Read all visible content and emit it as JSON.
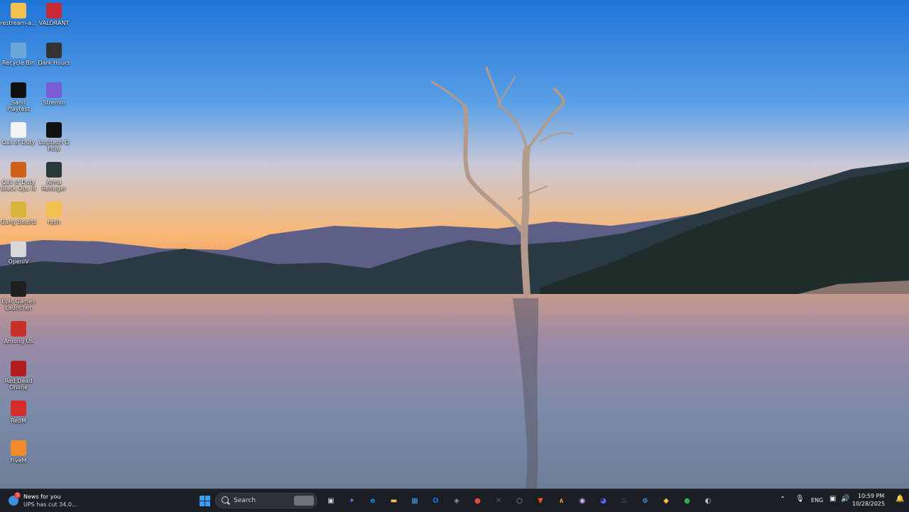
{
  "desktop": {
    "icons": [
      {
        "label": "restream-a...",
        "icon": "folder-icon",
        "color": "#f2c14e"
      },
      {
        "label": "VALORANT",
        "icon": "valorant-icon",
        "color": "#c62b33"
      },
      {
        "label": "Recycle Bin",
        "icon": "recycle-bin-icon",
        "color": "#6aa6d8"
      },
      {
        "label": "Dark Hours",
        "icon": "dark-hours-icon",
        "color": "#333333"
      },
      {
        "label": "Sand Playtest",
        "icon": "sand-icon",
        "color": "#111111"
      },
      {
        "label": "Stremio",
        "icon": "stremio-icon",
        "color": "#7b5bd6"
      },
      {
        "label": "Call of Duty",
        "icon": "file-icon",
        "color": "#f4f4f4"
      },
      {
        "label": "Logitech G HUB",
        "icon": "logitech-icon",
        "color": "#111111"
      },
      {
        "label": "Call of Duty Black Ops III",
        "icon": "black-ops-icon",
        "color": "#d0601a"
      },
      {
        "label": "Arma Reforger",
        "icon": "arma-icon",
        "color": "#2a3a3a"
      },
      {
        "label": "Gang Beasts",
        "icon": "gang-beasts-icon",
        "color": "#d9b43a"
      },
      {
        "label": "resh",
        "icon": "folder-icon",
        "color": "#f2c14e"
      },
      {
        "label": "OpenIV",
        "icon": "openiv-icon",
        "color": "#d8d8d8"
      },
      {
        "label": "Epic Games Launcher",
        "icon": "epic-games-icon",
        "color": "#202020"
      },
      {
        "label": "Among Us",
        "icon": "among-us-icon",
        "color": "#c8302a"
      },
      {
        "label": "Red Dead Online",
        "icon": "red-dead-icon",
        "color": "#b31c1c"
      },
      {
        "label": "RedM",
        "icon": "redm-icon",
        "color": "#d42b2b"
      },
      {
        "label": "FiveM",
        "icon": "fivem-icon",
        "color": "#f08a2a"
      }
    ]
  },
  "taskbar": {
    "news": {
      "title": "News for you",
      "subtitle": "UPS has cut 34,0...",
      "badge": "3"
    },
    "search": {
      "label": "Search"
    },
    "apps": [
      {
        "name": "start-button",
        "glyph": "⊞",
        "color": "#3aa0ff"
      },
      {
        "name": "task-view-button",
        "glyph": "▣",
        "color": "#cfd3dc"
      },
      {
        "name": "copilot-icon",
        "glyph": "✦",
        "color": "#8b6cf0"
      },
      {
        "name": "edge-icon",
        "glyph": "e",
        "color": "#1f8fdc"
      },
      {
        "name": "file-explorer-icon",
        "glyph": "▬",
        "color": "#f2c14e"
      },
      {
        "name": "microsoft-store-icon",
        "glyph": "▦",
        "color": "#4a9ae0"
      },
      {
        "name": "outlook-icon",
        "glyph": "O",
        "color": "#1a6ed4"
      },
      {
        "name": "unity-icon",
        "glyph": "◈",
        "color": "#8b8f99"
      },
      {
        "name": "chrome-icon",
        "glyph": "●",
        "color": "#e44b3a"
      },
      {
        "name": "terminal-icon",
        "glyph": "✕",
        "color": "#5a5e68"
      },
      {
        "name": "cycle-app-icon",
        "glyph": "◌",
        "color": "#ffffff"
      },
      {
        "name": "brave-icon",
        "glyph": "▼",
        "color": "#f0531c"
      },
      {
        "name": "fivem-taskbar-icon",
        "glyph": "∧",
        "color": "#f08a2a"
      },
      {
        "name": "circle-app-icon",
        "glyph": "◉",
        "color": "#d7b7ff"
      },
      {
        "name": "discord-icon",
        "glyph": "◕",
        "color": "#5865f2"
      },
      {
        "name": "steam-icon",
        "glyph": "♨",
        "color": "#3a8fd1"
      },
      {
        "name": "dxp-icon",
        "glyph": "⊛",
        "color": "#3a8fd1"
      },
      {
        "name": "gold-app-icon",
        "glyph": "◆",
        "color": "#f2c14e"
      },
      {
        "name": "chrome-alt-icon",
        "glyph": "●",
        "color": "#34a853"
      },
      {
        "name": "obs-icon",
        "glyph": "◐",
        "color": "#bbbbbb"
      }
    ],
    "tray": {
      "language": "ENG",
      "time": "10:59 PM",
      "date": "10/28/2025"
    }
  }
}
